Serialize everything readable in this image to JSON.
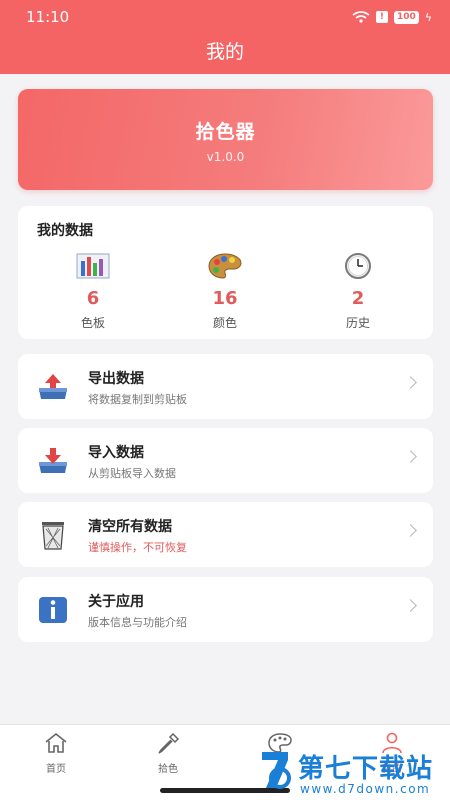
{
  "status_bar": {
    "time": "11:10",
    "battery": "100"
  },
  "header": {
    "title": "我的"
  },
  "hero": {
    "title": "拾色器",
    "version": "v1.0.0"
  },
  "stats": {
    "title": "我的数据",
    "items": [
      {
        "value": "6",
        "label": "色板",
        "icon": "bar-chart-icon"
      },
      {
        "value": "16",
        "label": "颜色",
        "icon": "palette-icon"
      },
      {
        "value": "2",
        "label": "历史",
        "icon": "clock-icon"
      }
    ]
  },
  "menu": [
    {
      "title": "导出数据",
      "subtitle": "将数据复制到剪贴板",
      "icon": "export-tray-icon"
    },
    {
      "title": "导入数据",
      "subtitle": "从剪贴板导入数据",
      "icon": "import-tray-icon"
    },
    {
      "title": "清空所有数据",
      "subtitle": "谨慎操作，不可恢复",
      "icon": "trash-icon",
      "warning": true
    },
    {
      "title": "关于应用",
      "subtitle": "版本信息与功能介绍",
      "icon": "info-icon"
    }
  ],
  "tabs": [
    {
      "label": "首页",
      "icon": "home-icon"
    },
    {
      "label": "拾色",
      "icon": "eyedropper-icon"
    },
    {
      "label": "",
      "icon": "palette-icon"
    },
    {
      "label": "我的",
      "icon": "profile-icon"
    }
  ],
  "watermark": {
    "name": "第七下载站",
    "url": "www.d7down.com"
  },
  "colors": {
    "accent": "#f46464",
    "stat_value": "#e25b5b",
    "watermark": "#1a7fd6"
  }
}
